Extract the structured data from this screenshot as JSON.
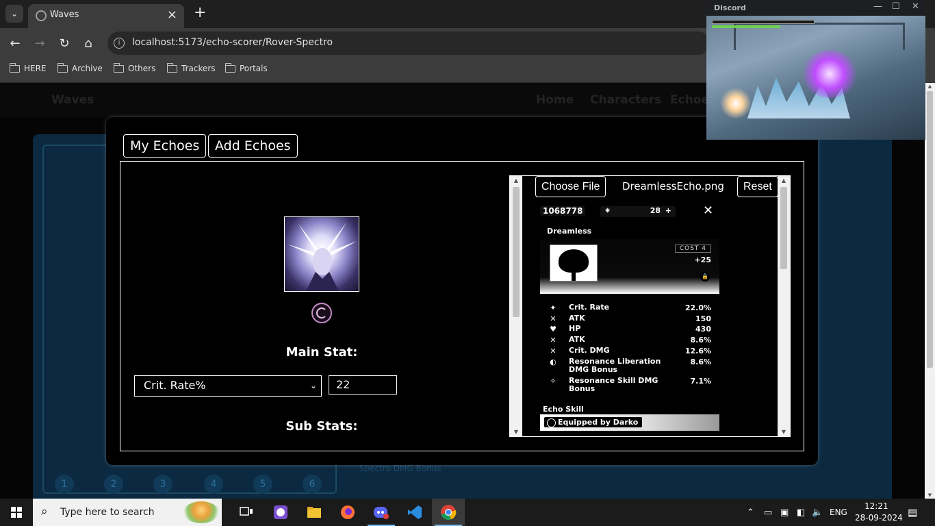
{
  "browser": {
    "tab_title": "Waves",
    "url": "localhost:5173/echo-scorer/Rover-Spectro",
    "bookmarks": [
      "HERE",
      "Archive",
      "Others",
      "Trackers",
      "Portals"
    ]
  },
  "background_nav": {
    "brand": "Waves",
    "links": [
      "Home",
      "Characters",
      "Echoes"
    ],
    "numbers": [
      "1",
      "2",
      "3",
      "4",
      "5",
      "6"
    ],
    "faded_row": "Spectro DMG Bonus"
  },
  "modal": {
    "tabs": [
      "My Echoes",
      "Add Echoes"
    ],
    "main_stat_label": "Main Stat:",
    "main_stat_selected": "Crit. Rate%",
    "main_stat_value": "22",
    "sub_stats_label": "Sub Stats:"
  },
  "uploader": {
    "choose_file_label": "Choose File",
    "file_name": "DreamlessEcho.png",
    "reset_label": "Reset"
  },
  "echo_card": {
    "id": "1068778",
    "level": "28",
    "name": "Dreamless",
    "cost": "COST 4",
    "upgrade": "+25",
    "stats": [
      {
        "icon": "✦",
        "name": "Crit. Rate",
        "value": "22.0%"
      },
      {
        "icon": "✕",
        "name": "ATK",
        "value": "150"
      },
      {
        "icon": "♥",
        "name": "HP",
        "value": "430"
      },
      {
        "icon": "✕",
        "name": "ATK",
        "value": "8.6%"
      },
      {
        "icon": "✕",
        "name": "Crit. DMG",
        "value": "12.6%"
      },
      {
        "icon": "◐",
        "name": "Resonance Liberation DMG Bonus",
        "value": "8.6%"
      },
      {
        "icon": "✧",
        "name": "Resonance Skill DMG Bonus",
        "value": "7.1%"
      }
    ],
    "skill_label": "Echo Skill",
    "equipped_by": "Equipped by Darko"
  },
  "discord": {
    "title": "Discord"
  },
  "taskbar": {
    "search_placeholder": "Type here to search",
    "language": "ENG",
    "time": "12:21",
    "date": "28-09-2024"
  }
}
